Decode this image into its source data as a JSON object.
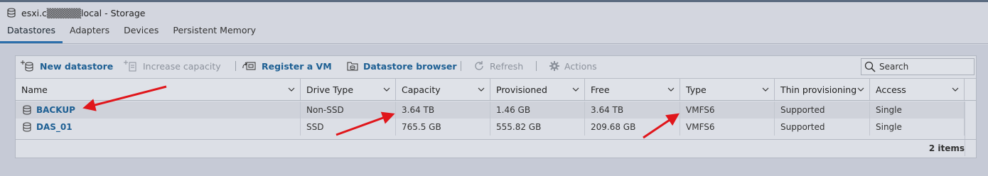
{
  "window": {
    "title": "esxi.c▒▒▒▒▒local - Storage",
    "icon": "database-icon"
  },
  "tabs": [
    {
      "label": "Datastores",
      "active": true
    },
    {
      "label": "Adapters",
      "active": false
    },
    {
      "label": "Devices",
      "active": false
    },
    {
      "label": "Persistent Memory",
      "active": false
    }
  ],
  "toolbar": {
    "new_datastore": "New datastore",
    "increase_capacity": "Increase capacity",
    "register_vm": "Register a VM",
    "datastore_browser": "Datastore browser",
    "refresh": "Refresh",
    "actions": "Actions"
  },
  "search": {
    "placeholder": "Search"
  },
  "table": {
    "columns": [
      "Name",
      "Drive Type",
      "Capacity",
      "Provisioned",
      "Free",
      "Type",
      "Thin provisioning",
      "Access"
    ],
    "rows": [
      {
        "name": "BACKUP",
        "drive_type": "Non-SSD",
        "capacity": "3.64 TB",
        "provisioned": "1.46 GB",
        "free": "3.64 TB",
        "type": "VMFS6",
        "thin": "Supported",
        "access": "Single"
      },
      {
        "name": "DAS_01",
        "drive_type": "SSD",
        "capacity": "765.5 GB",
        "provisioned": "555.82 GB",
        "free": "209.68 GB",
        "type": "VMFS6",
        "thin": "Supported",
        "access": "Single"
      }
    ],
    "item_count": "2 items"
  },
  "colors": {
    "accent": "#1d5f93",
    "annotation_arrow": "#e0161b",
    "active_tab_underline": "#2c6fab"
  }
}
